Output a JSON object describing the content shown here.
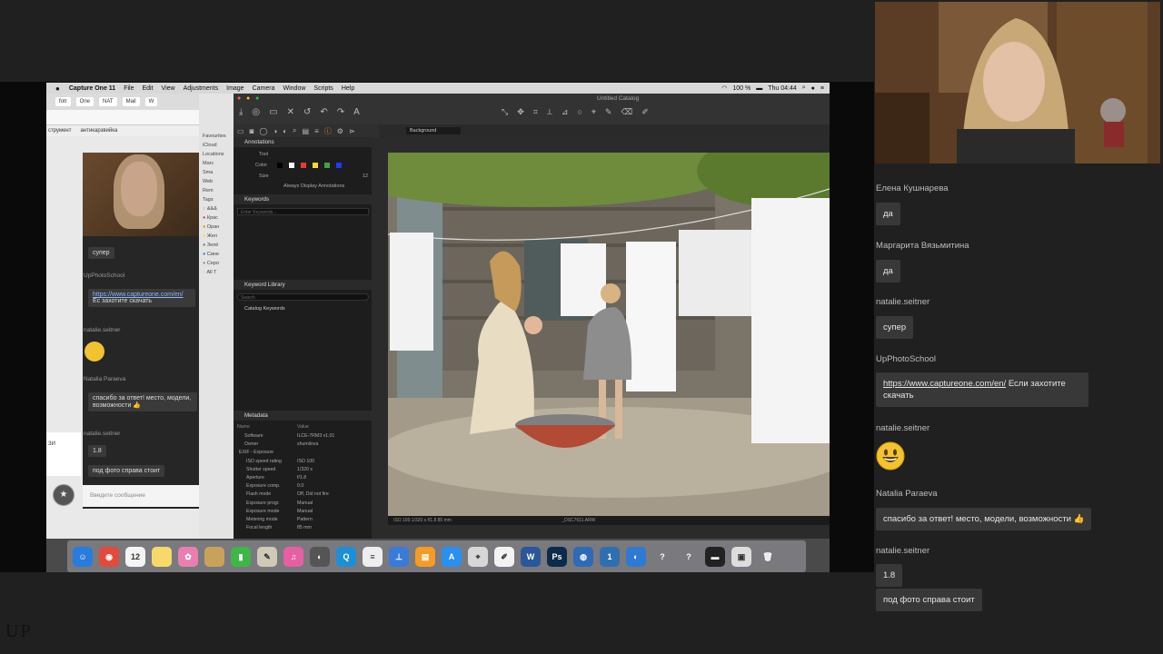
{
  "mac": {
    "apple": "",
    "app_name": "Capture One 11",
    "menus": [
      "File",
      "Edit",
      "View",
      "Adjustments",
      "Image",
      "Camera",
      "Window",
      "Scripts",
      "Help"
    ],
    "battery": "100 %",
    "clock": "Thu 04:44"
  },
  "browser": {
    "tabs": [
      "fotr",
      "One",
      "NAT",
      "Mail",
      "W"
    ],
    "bookmarks": [
      "струмент",
      "антикарзвийка"
    ]
  },
  "inner_chat": {
    "messages": [
      {
        "type": "msg",
        "text": "супер"
      },
      {
        "type": "name",
        "text": "UpPhotoSchool"
      },
      {
        "type": "link",
        "text": "https://www.captureone.com/en/",
        "suffix": "Ес захотите скачать"
      },
      {
        "type": "name",
        "text": "natalie.seitner"
      },
      {
        "type": "name",
        "text": "Natalia Paraeva"
      },
      {
        "type": "msg",
        "text": "спасибо за ответ! место, модели, возможности 👍"
      },
      {
        "type": "name",
        "text": "natalie.seitner"
      },
      {
        "type": "msg",
        "text": "1.8"
      },
      {
        "type": "msg",
        "text": "под фото справа стоит"
      }
    ],
    "input_placeholder": "Введите сообщение",
    "popup_text": "ЗИ"
  },
  "finder_sidebar": {
    "favourites": "Favourites",
    "icloud": "iCloud",
    "locations": "Locations",
    "tags": "Tags",
    "items": [
      "Marc",
      "Sma",
      "Web",
      "Rem"
    ],
    "tag_items": [
      "&&&",
      "Крас",
      "Оран",
      "Жел",
      "Зелё",
      "Сине",
      "Серо",
      "All T"
    ],
    "tag_colors": [
      "#ffffff",
      "#e53935",
      "#fb8c00",
      "#fdd835",
      "#43a047",
      "#1e88e5",
      "#8e8e8e",
      "#cccccc"
    ]
  },
  "capture_one": {
    "title": "Untitled Catalog",
    "annotations": {
      "header": "Annotations",
      "tool_label": "Tool",
      "color_label": "Color",
      "size_label": "Size",
      "size_value": "12",
      "always_display": "Always Display Annotations",
      "colors": [
        "#000000",
        "#ffffff",
        "#e53935",
        "#fdd835",
        "#43a047",
        "#1e3aff"
      ]
    },
    "keywords": {
      "header": "Keywords",
      "placeholder": "Enter Keywords..."
    },
    "keyword_library": {
      "header": "Keyword Library",
      "search_placeholder": "Search",
      "catalog_keywords": "Catalog Keywords"
    },
    "metadata": {
      "header": "Metadata",
      "col_name": "Name",
      "col_value": "Value",
      "rows": [
        {
          "name": "Software",
          "value": "ILCE-7RM3 v1.01"
        },
        {
          "name": "Owner",
          "value": "shumilova"
        },
        {
          "name": "EXIF - Exposure",
          "value": ""
        },
        {
          "name": "ISO speed rating",
          "value": "ISO 100"
        },
        {
          "name": "Shutter speed",
          "value": "1/320 s"
        },
        {
          "name": "Aperture",
          "value": "f/1.8"
        },
        {
          "name": "Exposure comp.",
          "value": "0.0"
        },
        {
          "name": "Flash mode",
          "value": "Off, Did not fire"
        },
        {
          "name": "Exposure progr.",
          "value": "Manual"
        },
        {
          "name": "Exposure mode",
          "value": "Manual"
        },
        {
          "name": "Metering mode",
          "value": "Pattern"
        },
        {
          "name": "Focal length",
          "value": "85 mm"
        }
      ]
    },
    "viewer_background": "Background",
    "photo_status_left": "ISO 100   1/320 s   f/1.8   85 mm",
    "photo_status_file": "_DSC7611.ARW"
  },
  "dock": {
    "icons": [
      {
        "name": "finder-icon",
        "label": "☺",
        "color": "#2a7bde"
      },
      {
        "name": "chrome-icon",
        "label": "◉",
        "color": "#e24a3b"
      },
      {
        "name": "calendar-icon",
        "label": "12",
        "color": "#f4f4f4"
      },
      {
        "name": "notes-icon",
        "label": "",
        "color": "#f7d96b"
      },
      {
        "name": "photos-icon",
        "label": "✿",
        "color": "#e97fb0"
      },
      {
        "name": "preview-icon",
        "label": "",
        "color": "#c8a25a"
      },
      {
        "name": "numbers-icon",
        "label": "▮",
        "color": "#3fb54a"
      },
      {
        "name": "script-icon",
        "label": "✎",
        "color": "#d0c9b8"
      },
      {
        "name": "itunes-icon",
        "label": "♫",
        "color": "#e65fa3"
      },
      {
        "name": "capture-one-icon",
        "label": "◐",
        "color": "#555555"
      },
      {
        "name": "quicktime-icon",
        "label": "Q",
        "color": "#1d8fd6"
      },
      {
        "name": "textedit-icon",
        "label": "≡",
        "color": "#eeeeee"
      },
      {
        "name": "keynote-icon",
        "label": "⊥",
        "color": "#3b7bd8"
      },
      {
        "name": "books-icon",
        "label": "▤",
        "color": "#f49c25"
      },
      {
        "name": "appstore-icon",
        "label": "A",
        "color": "#2b8ff0"
      },
      {
        "name": "preview2-icon",
        "label": "⌖",
        "color": "#d7d7d7"
      },
      {
        "name": "pages-icon",
        "label": "✐",
        "color": "#f3f3f3"
      },
      {
        "name": "word-icon",
        "label": "W",
        "color": "#2b579a"
      },
      {
        "name": "photoshop-icon",
        "label": "Ps",
        "color": "#0c2b4a"
      },
      {
        "name": "network-icon",
        "label": "◍",
        "color": "#2d6bb8"
      },
      {
        "name": "one-icon",
        "label": "1",
        "color": "#2f6fb0"
      },
      {
        "name": "globe-icon",
        "label": "◐",
        "color": "#2f7ad1"
      },
      {
        "name": "help-icon",
        "label": "?",
        "color": "transparent"
      },
      {
        "name": "help2-icon",
        "label": "?",
        "color": "transparent"
      },
      {
        "name": "terminal-icon",
        "label": "▬",
        "color": "#222222"
      },
      {
        "name": "screenshot-icon",
        "label": "▣",
        "color": "#dddddd"
      },
      {
        "name": "trash-icon",
        "label": "🗑",
        "color": "transparent"
      }
    ]
  },
  "chat": {
    "messages": [
      {
        "name": "Елена Кушнарева",
        "text": "да"
      },
      {
        "name": "Маргарита Вязьмитина",
        "text": "да"
      },
      {
        "name": "natalie.seitner",
        "text": "супер"
      },
      {
        "name": "UpPhotoSchool",
        "link": "https://www.captureone.com/en/",
        "text": " Если захотите скачать"
      },
      {
        "name": "natalie.seitner",
        "emoji": "😃"
      },
      {
        "name": "Natalia Paraeva",
        "text": "спасибо за ответ! место, модели, возможности 👍"
      },
      {
        "name": "natalie.seitner",
        "text": "1.8"
      },
      {
        "name": "",
        "text": "под фото справа стоит"
      }
    ]
  },
  "watermark": "UP"
}
